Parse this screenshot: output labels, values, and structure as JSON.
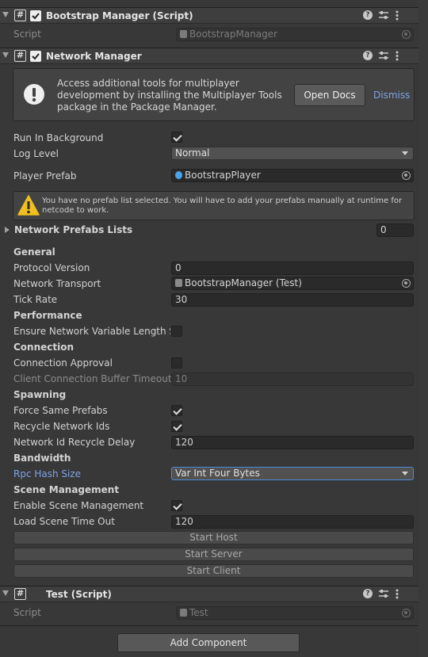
{
  "bootstrap_component": {
    "title": "Bootstrap Manager (Script)",
    "script_label": "Script",
    "script_value": "BootstrapManager"
  },
  "network_manager": {
    "title": "Network Manager",
    "info_box": {
      "text": "Access additional tools for multiplayer development by installing the Multiplayer Tools package in the Package Manager.",
      "open_docs_label": "Open Docs",
      "dismiss_label": "Dismiss"
    },
    "run_in_background_label": "Run In Background",
    "run_in_background": true,
    "log_level_label": "Log Level",
    "log_level_value": "Normal",
    "player_prefab_label": "Player Prefab",
    "player_prefab_value": "BootstrapPlayer",
    "warning_text": "You have no prefab list selected. You will have to add your prefabs manually at runtime for netcode to work.",
    "prefab_lists_label": "Network Prefabs Lists",
    "prefab_lists_count": "0",
    "general_header": "General",
    "protocol_version_label": "Protocol Version",
    "protocol_version_value": "0",
    "network_transport_label": "Network Transport",
    "network_transport_value": "BootstrapManager (Test)",
    "tick_rate_label": "Tick Rate",
    "tick_rate_value": "30",
    "performance_header": "Performance",
    "ensure_length_label": "Ensure Network Variable Length Sa",
    "ensure_length": false,
    "connection_header": "Connection",
    "connection_approval_label": "Connection Approval",
    "connection_approval": false,
    "client_buffer_label": "Client Connection Buffer Timeout",
    "client_buffer_value": "10",
    "spawning_header": "Spawning",
    "force_same_prefabs_label": "Force Same Prefabs",
    "force_same_prefabs": true,
    "recycle_ids_label": "Recycle Network Ids",
    "recycle_ids": true,
    "recycle_delay_label": "Network Id Recycle Delay",
    "recycle_delay_value": "120",
    "bandwidth_header": "Bandwidth",
    "rpc_hash_label": "Rpc Hash Size",
    "rpc_hash_value": "Var Int Four Bytes",
    "scene_header": "Scene Management",
    "enable_scene_label": "Enable Scene Management",
    "enable_scene": true,
    "load_timeout_label": "Load Scene Time Out",
    "load_timeout_value": "120",
    "start_host_label": "Start Host",
    "start_server_label": "Start Server",
    "start_client_label": "Start Client"
  },
  "test_component": {
    "title": "Test (Script)",
    "script_label": "Script",
    "script_value": "Test"
  },
  "add_component_label": "Add Component",
  "colors": {
    "background": "#383838",
    "header": "#3e3e3e",
    "accent_blue": "#7ea3e6",
    "warning_yellow": "#f0c020"
  },
  "icons": [
    "script-icon",
    "checkbox-icon",
    "help-icon",
    "presets-icon",
    "kebab-menu-icon",
    "info-icon",
    "warning-icon",
    "object-picker-icon",
    "dropdown-arrow-icon",
    "foldout-arrow-icon"
  ]
}
